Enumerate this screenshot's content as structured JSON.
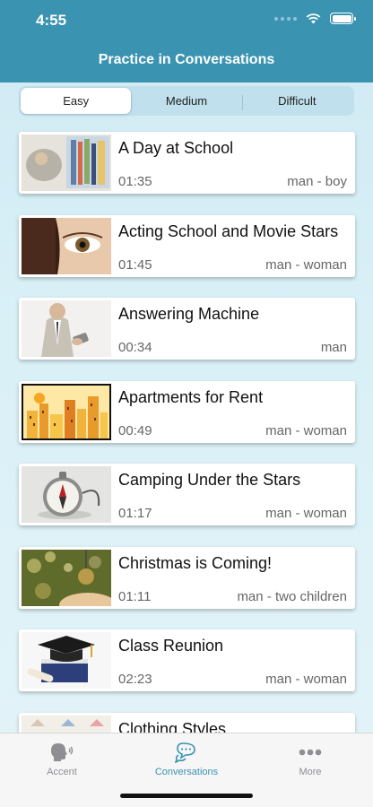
{
  "status": {
    "time": "4:55"
  },
  "header": {
    "title": "Practice in Conversations"
  },
  "segments": [
    {
      "label": "Easy",
      "selected": true
    },
    {
      "label": "Medium",
      "selected": false
    },
    {
      "label": "Difficult",
      "selected": false
    }
  ],
  "lessons": [
    {
      "title": "A Day at School",
      "duration": "01:35",
      "speakers": "man - boy"
    },
    {
      "title": "Acting School and Movie Stars",
      "duration": "01:45",
      "speakers": "man - woman"
    },
    {
      "title": "Answering Machine",
      "duration": "00:34",
      "speakers": "man"
    },
    {
      "title": "Apartments for Rent",
      "duration": "00:49",
      "speakers": "man - woman"
    },
    {
      "title": "Camping Under the Stars",
      "duration": "01:17",
      "speakers": "man - woman"
    },
    {
      "title": "Christmas is Coming!",
      "duration": "01:11",
      "speakers": "man - two children"
    },
    {
      "title": "Class Reunion",
      "duration": "02:23",
      "speakers": "man - woman"
    },
    {
      "title": "Clothing Styles",
      "duration": "",
      "speakers": ""
    }
  ],
  "tabs": [
    {
      "label": "Accent",
      "icon": "head-speaking-icon"
    },
    {
      "label": "Conversations",
      "icon": "chat-bubbles-icon"
    },
    {
      "label": "More",
      "icon": "more-dots-icon"
    }
  ],
  "colors": {
    "accent": "#3a93b1",
    "tab_inactive": "#8e8e93"
  }
}
